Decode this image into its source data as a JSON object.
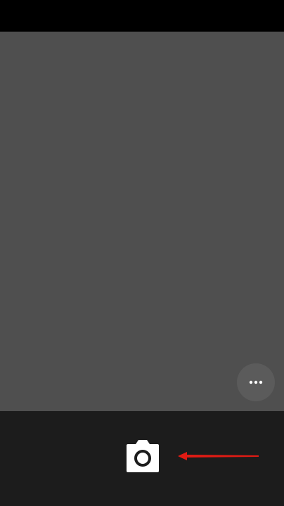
{
  "app": {
    "screen": "camera-viewfinder"
  },
  "icons": {
    "more": "more-horizontal-icon",
    "shutter": "camera-icon",
    "annotation": "red-arrow-left"
  },
  "colors": {
    "status_bar": "#000000",
    "viewfinder": "#4f4f4f",
    "more_button_bg": "#5b5b5b",
    "bottom_bar": "#1c1c1c",
    "shutter_icon": "#ffffff",
    "annotation_arrow": "#e11b14"
  }
}
